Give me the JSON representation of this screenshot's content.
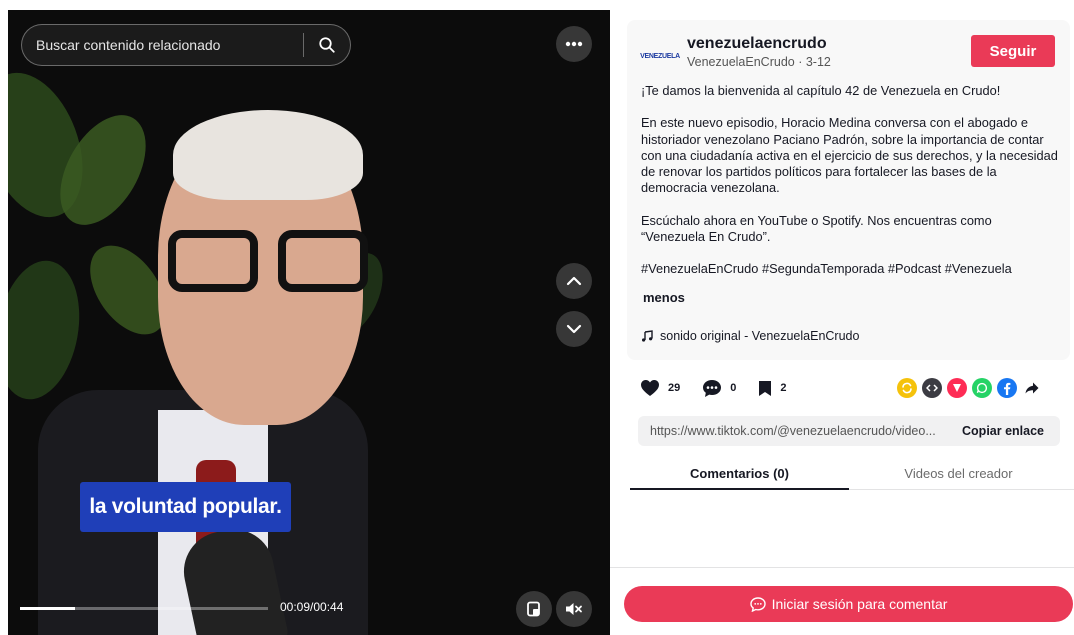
{
  "video": {
    "search_placeholder": "Buscar contenido relacionado",
    "caption": "la voluntad popular.",
    "time": "00:09/00:44",
    "progress": 0.22
  },
  "author": {
    "logo_text": "VENEZUELA",
    "username": "venezuelaencrudo",
    "display_name": "VenezuelaEnCrudo",
    "date": "3-12",
    "follow_label": "Seguir"
  },
  "description": {
    "paragraphs": [
      "¡Te damos la bienvenida al capítulo 42 de Venezuela en Crudo!",
      "En este nuevo episodio, Horacio Medina conversa con el abogado e historiador venezolano Paciano Padrón, sobre la importancia de contar con una ciudadanía activa en el ejercicio de sus derechos, y la necesidad de renovar los partidos políticos para fortalecer las bases de la democracia venezolana.",
      "Escúchalo ahora en YouTube o Spotify. Nos encuentras como “Venezuela En Crudo”.",
      "#VenezuelaEnCrudo #SegundaTemporada #Podcast #Venezuela"
    ],
    "less_label": "menos",
    "sound": "sonido original - VenezuelaEnCrudo"
  },
  "stats": {
    "likes": "29",
    "comments": "0",
    "saves": "2"
  },
  "share": {
    "url": "https://www.tiktok.com/@venezuelaencrudo/video...",
    "copy_label": "Copiar enlace"
  },
  "tabs": [
    {
      "label": "Comentarios (0)"
    },
    {
      "label": "Videos del creador"
    }
  ],
  "login_label": "Iniciar sesión para comentar",
  "colors": {
    "accent": "#ea3a57",
    "caption_bg": "#1f3fb8"
  }
}
